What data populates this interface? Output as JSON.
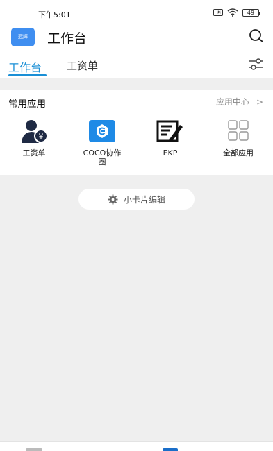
{
  "status_bar": {
    "time": "下午5:01",
    "battery": "49"
  },
  "header": {
    "logo_text": "冠辉",
    "title": "工作台"
  },
  "tabs": [
    {
      "label": "工作台",
      "active": true
    },
    {
      "label": "工资单",
      "active": false
    }
  ],
  "apps_section": {
    "title": "常用应用",
    "center_link": "应用中心",
    "items": [
      {
        "label": "工资单",
        "icon": "payroll-icon"
      },
      {
        "label": "COCO协作圈",
        "icon": "coco-icon"
      },
      {
        "label": "EKP",
        "icon": "ekp-icon"
      },
      {
        "label": "全部应用",
        "icon": "all-apps-icon"
      }
    ]
  },
  "card_edit": {
    "label": "小卡片编辑"
  },
  "colors": {
    "accent": "#1a8fd6",
    "logo": "#3f8ef0",
    "coco": "#1e8ae6",
    "background": "#efefef"
  }
}
